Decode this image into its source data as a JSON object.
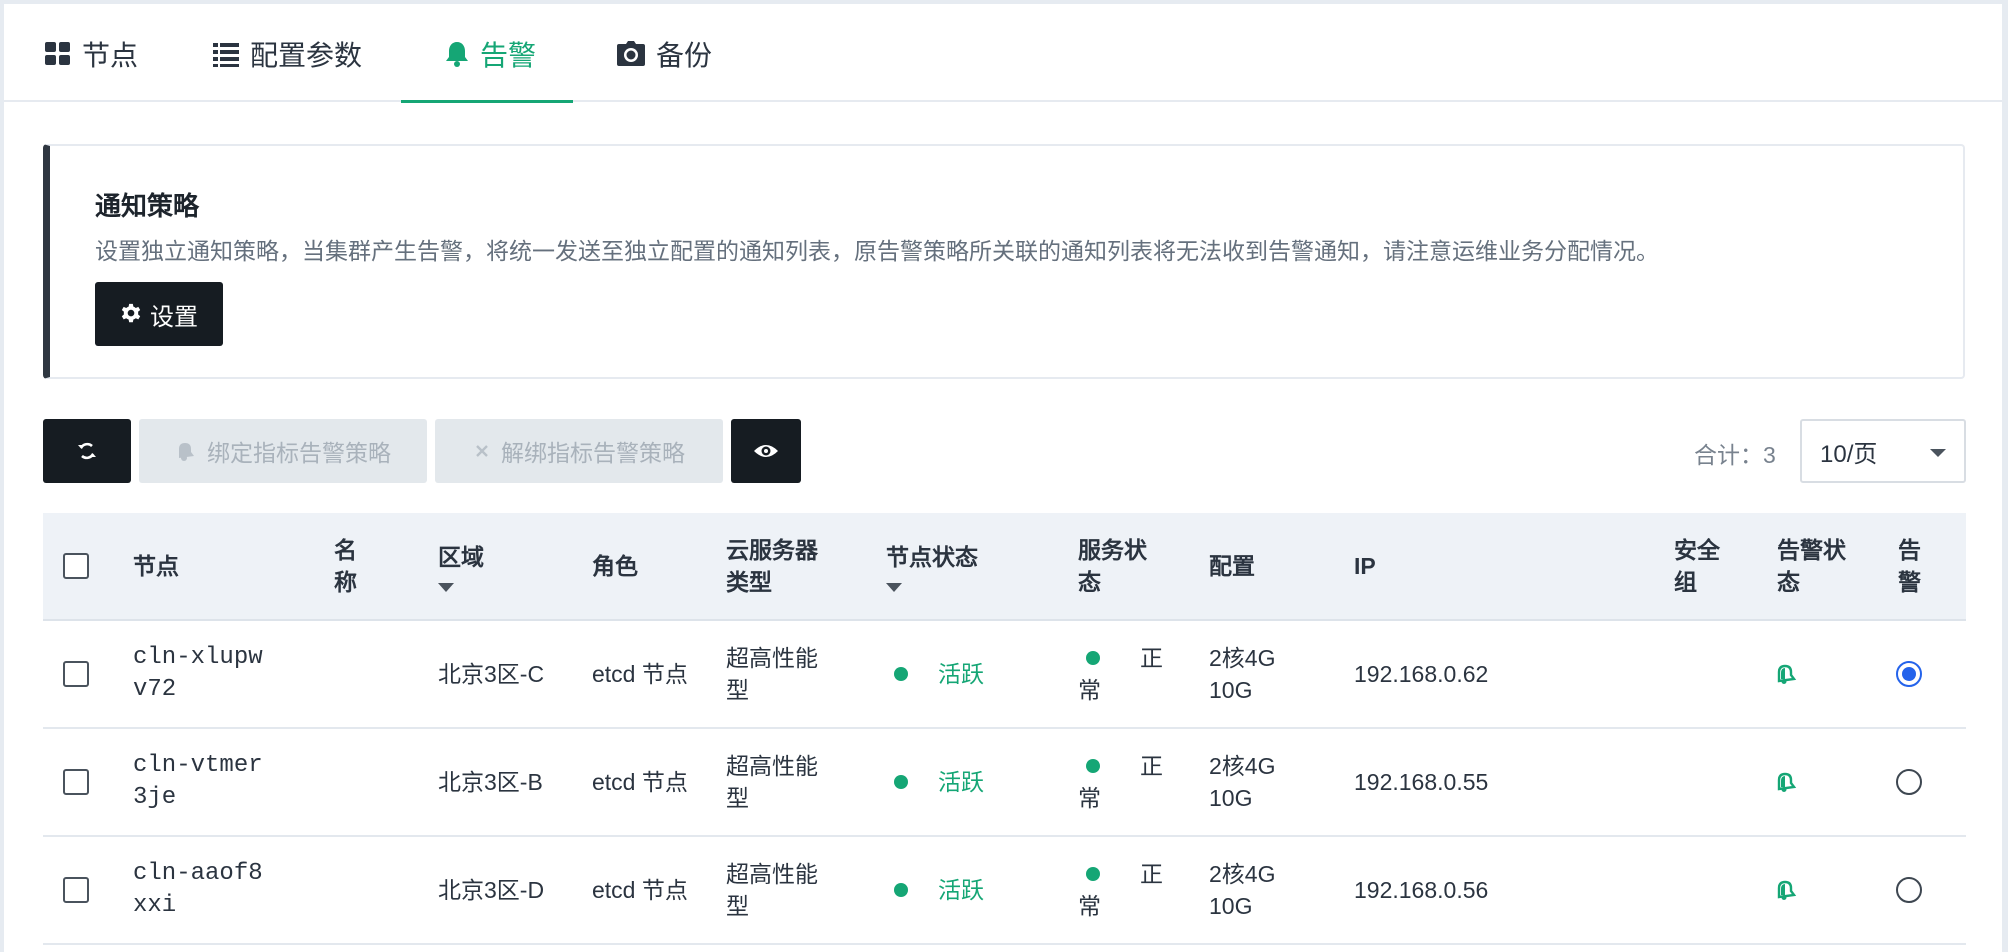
{
  "tabs": [
    {
      "label": "节点",
      "icon": "grid-icon",
      "active": false
    },
    {
      "label": "配置参数",
      "icon": "list-icon",
      "active": false
    },
    {
      "label": "告警",
      "icon": "bell-icon",
      "active": true
    },
    {
      "label": "备份",
      "icon": "camera-icon",
      "active": false
    }
  ],
  "notify": {
    "title": "通知策略",
    "description": "设置独立通知策略，当集群产生告警，将统一发送至独立配置的通知列表，原告警策略所关联的通知列表将无法收到告警通知，请注意运维业务分配情况。",
    "settings_label": "设置"
  },
  "toolbar": {
    "bind_label": "绑定指标告警策略",
    "unbind_label": "解绑指标告警策略",
    "total_label": "合计：3",
    "page_size": "10/页"
  },
  "table": {
    "columns": [
      "节点",
      "名称",
      "区域",
      "角色",
      "云服务器类型",
      "节点状态",
      "服务状态",
      "配置",
      "IP",
      "安全组",
      "告警状态",
      "告警"
    ],
    "rows": [
      {
        "node": "cln-xlupwv72",
        "name": "",
        "region": "北京3区-C",
        "role": "etcd 节点",
        "type": "超高性能型",
        "node_status": "活跃",
        "service_status": [
          "正",
          "常"
        ],
        "config": [
          "2核4G",
          "10G"
        ],
        "ip": "192.168.0.62",
        "security_group": "",
        "alarm_selected": true
      },
      {
        "node": "cln-vtmer3je",
        "name": "",
        "region": "北京3区-B",
        "role": "etcd 节点",
        "type": "超高性能型",
        "node_status": "活跃",
        "service_status": [
          "正",
          "常"
        ],
        "config": [
          "2核4G",
          "10G"
        ],
        "ip": "192.168.0.55",
        "security_group": "",
        "alarm_selected": false
      },
      {
        "node": "cln-aaof8xxi",
        "name": "",
        "region": "北京3区-D",
        "role": "etcd 节点",
        "type": "超高性能型",
        "node_status": "活跃",
        "service_status": [
          "正",
          "常"
        ],
        "config": [
          "2核4G",
          "10G"
        ],
        "ip": "192.168.0.56",
        "security_group": "",
        "alarm_selected": false
      }
    ]
  },
  "colors": {
    "accent": "#15a675",
    "dark": "#161c22",
    "radio_selected": "#2463eb"
  }
}
